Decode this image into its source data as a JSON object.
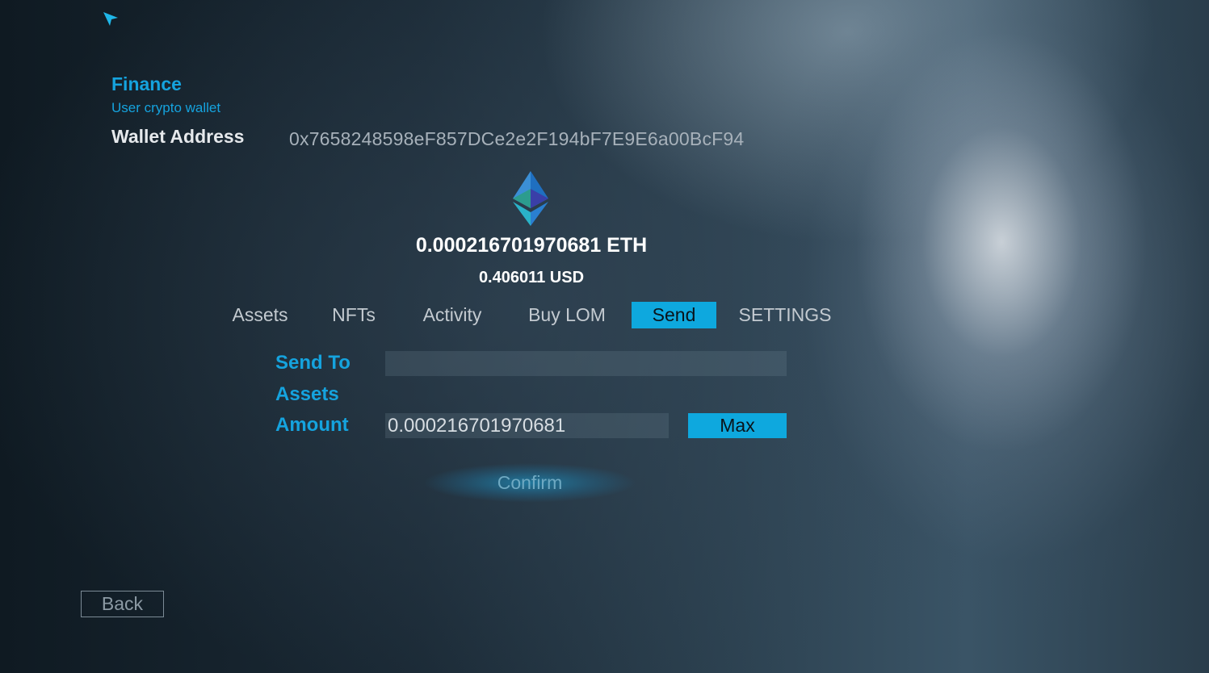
{
  "header": {
    "title": "Finance",
    "subtitle": "User crypto wallet"
  },
  "wallet": {
    "label": "Wallet Address",
    "address": "0x7658248598eF857DCe2e2F194bF7E9E6a00BcF94"
  },
  "balance": {
    "icon": "ethereum-icon",
    "eth": "0.000216701970681 ETH",
    "usd": "0.406011 USD"
  },
  "tabs": [
    {
      "label": "Assets"
    },
    {
      "label": "NFTs"
    },
    {
      "label": "Activity"
    },
    {
      "label": "Buy LOM"
    },
    {
      "label": "Send",
      "active": true
    },
    {
      "label": "SETTINGS"
    }
  ],
  "send_form": {
    "send_to_label": "Send To",
    "send_to_value": "",
    "assets_label": "Assets",
    "amount_label": "Amount",
    "amount_value": "0.000216701970681",
    "max_label": "Max",
    "confirm_label": "Confirm"
  },
  "footer": {
    "back_label": "Back"
  },
  "colors": {
    "accent": "#0ea8de",
    "label_blue": "#15a3de"
  }
}
